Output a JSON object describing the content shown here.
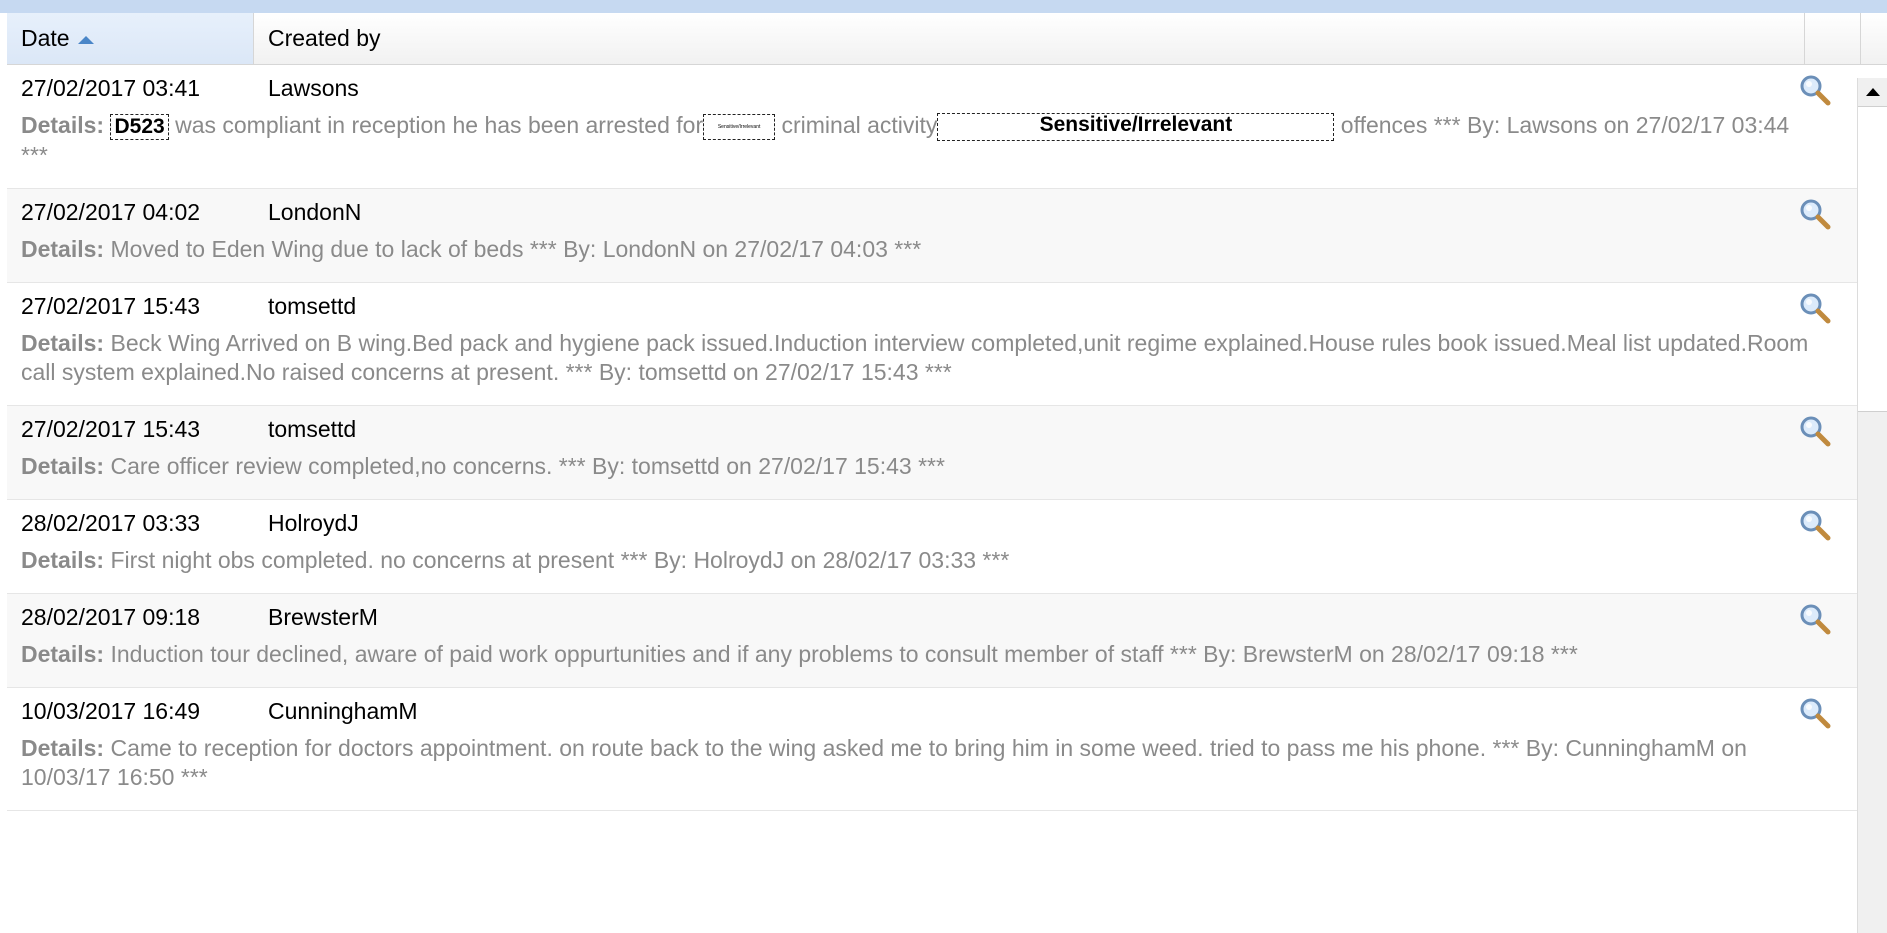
{
  "header": {
    "date_label": "Date",
    "created_by_label": "Created by",
    "sort": "ascending"
  },
  "details_label": "Details:",
  "rows": [
    {
      "date": "27/02/2017 03:41",
      "user": "Lawsons",
      "redacted_id": "D523",
      "text_1": " was compliant in reception he has been arrested for",
      "redacted_small": "Sensitive/Irrelevant",
      "text_2": " criminal activity",
      "redacted_wide": "Sensitive/Irrelevant",
      "text_3": " offences *** By: Lawsons on 27/02/17 03:44 ***"
    },
    {
      "date": "27/02/2017 04:02",
      "user": "LondonN",
      "text": "Moved to Eden Wing due to lack of beds *** By: LondonN on 27/02/17 04:03 ***"
    },
    {
      "date": "27/02/2017 15:43",
      "user": "tomsettd",
      "text": "Beck Wing Arrived on B wing.Bed pack and hygiene pack issued.Induction interview completed,unit regime explained.House rules book issued.Meal list updated.Room call system explained.No raised concerns at present. *** By: tomsettd on 27/02/17 15:43 ***"
    },
    {
      "date": "27/02/2017 15:43",
      "user": "tomsettd",
      "text": "Care officer review completed,no concerns. *** By: tomsettd on 27/02/17 15:43 ***"
    },
    {
      "date": "28/02/2017 03:33",
      "user": "HolroydJ",
      "text": "First night obs completed. no concerns at present *** By: HolroydJ on 28/02/17 03:33 ***"
    },
    {
      "date": "28/02/2017 09:18",
      "user": "BrewsterM",
      "text": "Induction tour declined, aware of paid work oppurtunities and if any problems to consult member of staff *** By: BrewsterM on 28/02/17 09:18 ***"
    },
    {
      "date": "10/03/2017 16:49",
      "user": "CunninghamM",
      "text": "Came to reception for doctors appointment. on route back to the wing asked me to bring him in some weed. tried to pass me his phone. *** By: CunninghamM on 10/03/17 16:50 ***"
    }
  ],
  "icons": {
    "row_action": "magnifier-icon",
    "scroll_up": "arrow-up-icon"
  },
  "colors": {
    "header_selected": "#dbe7f7",
    "sort_arrow": "#4a86c8",
    "details_text": "#8a8a8a",
    "frame_top": "#c6d9f1"
  }
}
